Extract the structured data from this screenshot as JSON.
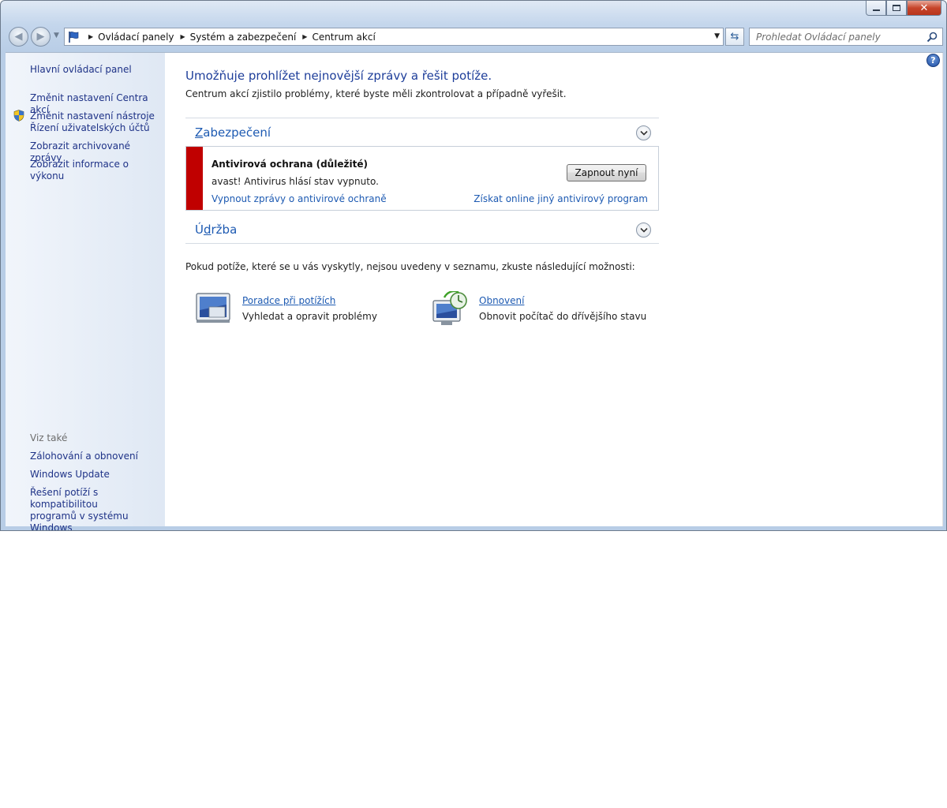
{
  "window": {
    "caption_buttons": {
      "close": "✕"
    }
  },
  "navigation": {
    "breadcrumbs": [
      {
        "label": "Ovládací panely"
      },
      {
        "label": "Systém a zabezpečení"
      },
      {
        "label": "Centrum akcí"
      }
    ],
    "search_placeholder": "Prohledat Ovládací panely"
  },
  "sidebar": {
    "items": [
      {
        "label": "Hlavní ovládací panel"
      },
      {
        "label": "Změnit nastavení Centra akcí"
      },
      {
        "label": "Změnit nastavení nástroje\nŘízení uživatelských účtů",
        "icon": "uac-shield-icon"
      },
      {
        "label": "Zobrazit archivované zprávy"
      },
      {
        "label": "Zobrazit informace o výkonu"
      }
    ],
    "see_also_title": "Viz také",
    "see_also": [
      {
        "label": "Zálohování a obnovení"
      },
      {
        "label": "Windows Update"
      },
      {
        "label": "Řešení potíží s kompatibilitou\nprogramů v systému Windows"
      }
    ]
  },
  "main": {
    "title": "Umožňuje prohlížet nejnovější zprávy a řešit potíže.",
    "subtitle": "Centrum akcí zjistilo problémy, které byste měli zkontrolovat a případně vyřešit.",
    "security_section": {
      "title_prefix": "",
      "title_underlined": "Z",
      "title_rest": "abezpečení"
    },
    "alert": {
      "title": "Antivirová ochrana  (důležité)",
      "text": "avast! Antivirus hlásí stav vypnuto.",
      "button_label": "Zapnout nyní",
      "link_disable": "Vypnout zprávy o antivirové ochraně",
      "link_online": "Získat online jiný antivirový program",
      "status_color": "#c00000"
    },
    "maintenance_section": {
      "title_prefix": "Ú",
      "title_underlined": "d",
      "title_rest": "ržba"
    },
    "hint": "Pokud potíže, které se u vás vyskytly, nejsou uvedeny v seznamu, zkuste následující možnosti:",
    "tools": [
      {
        "link": "Poradce při potížích",
        "desc": "Vyhledat a opravit problémy",
        "icon": "troubleshooting-icon"
      },
      {
        "link": "Obnovení",
        "desc": "Obnovit počítač do dřívějšího stavu",
        "icon": "recovery-icon"
      }
    ]
  }
}
